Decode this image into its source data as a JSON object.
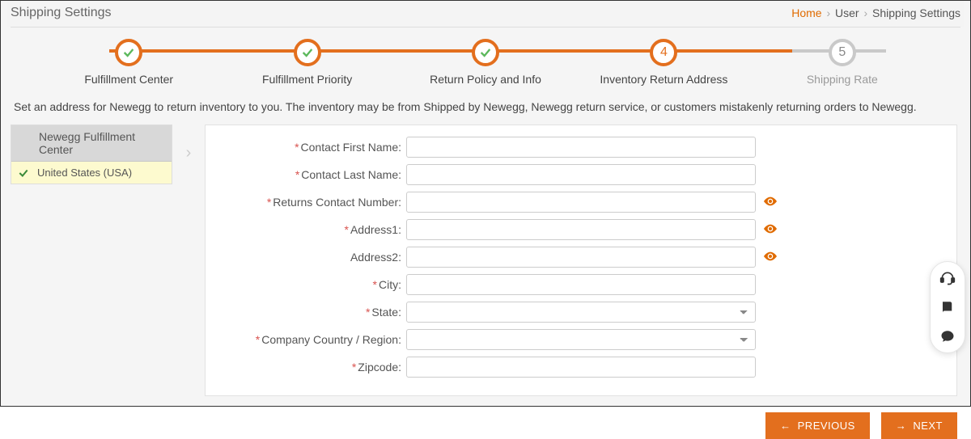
{
  "header": {
    "title": "Shipping Settings",
    "breadcrumb": {
      "home": "Home",
      "user": "User",
      "current": "Shipping Settings"
    }
  },
  "stepper": {
    "steps": [
      {
        "label": "Fulfillment Center",
        "state": "done"
      },
      {
        "label": "Fulfillment Priority",
        "state": "done"
      },
      {
        "label": "Return Policy and Info",
        "state": "done"
      },
      {
        "label": "Inventory Return Address",
        "state": "active",
        "number": "4"
      },
      {
        "label": "Shipping Rate",
        "state": "pending",
        "number": "5"
      }
    ]
  },
  "description": "Set an address for Newegg to return inventory to you. The inventory may be from Shipped by Newegg, Newegg return service, or customers mistakenly returning orders to Newegg.",
  "sidebar": {
    "header": "Newegg Fulfillment Center",
    "items": [
      {
        "label": "United States (USA)",
        "selected": true
      }
    ]
  },
  "form": {
    "fields": {
      "contact_first_name": {
        "label": "Contact First Name:",
        "required": true,
        "value": ""
      },
      "contact_last_name": {
        "label": "Contact Last Name:",
        "required": true,
        "value": ""
      },
      "returns_contact_number": {
        "label": "Returns Contact Number:",
        "required": true,
        "value": "",
        "eye": true
      },
      "address1": {
        "label": "Address1:",
        "required": true,
        "value": "",
        "eye": true
      },
      "address2": {
        "label": "Address2:",
        "required": false,
        "value": "",
        "eye": true
      },
      "city": {
        "label": "City:",
        "required": true,
        "value": ""
      },
      "state": {
        "label": "State:",
        "required": true,
        "value": ""
      },
      "country": {
        "label": "Company Country / Region:",
        "required": true,
        "value": ""
      },
      "zipcode": {
        "label": "Zipcode:",
        "required": true,
        "value": ""
      }
    }
  },
  "buttons": {
    "previous": "PREVIOUS",
    "next": "NEXT"
  },
  "icons": {
    "check_color": "#5cb85c",
    "accent": "#e36f1e"
  }
}
